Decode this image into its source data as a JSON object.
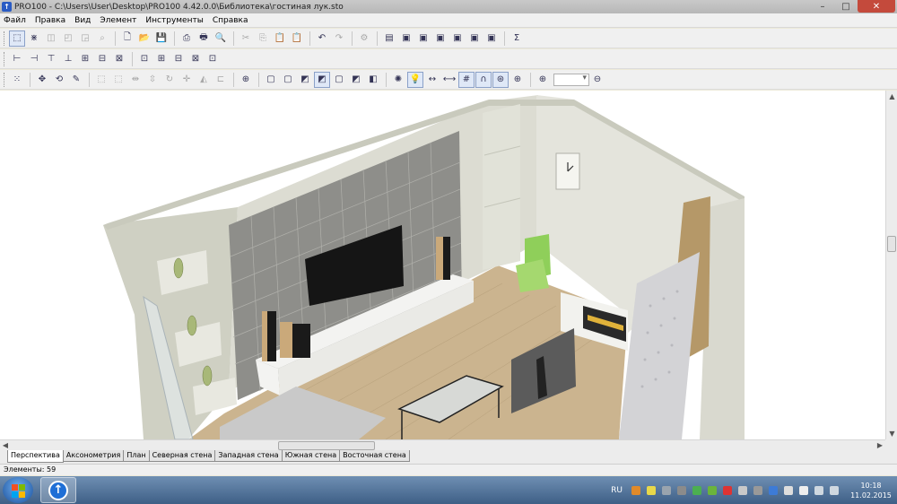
{
  "window": {
    "title": "PRO100 - C:\\Users\\User\\Desktop\\PRO100 4.42.0.0\\Библиотека\\гостиная лук.sto",
    "minimize": "–",
    "maximize": "□",
    "close": "✕"
  },
  "menu": [
    "Файл",
    "Правка",
    "Вид",
    "Элемент",
    "Инструменты",
    "Справка"
  ],
  "toolbar1": {
    "buttons": [
      {
        "icon": "cursor-select-icon",
        "glyph": "⬚",
        "state": "selected"
      },
      {
        "icon": "grid-select-icon",
        "glyph": "⋇",
        "state": "normal"
      },
      {
        "icon": "box-icon",
        "glyph": "◫",
        "state": "disabled"
      },
      {
        "icon": "box-rotate-icon",
        "glyph": "◰",
        "state": "disabled"
      },
      {
        "icon": "box-group-icon",
        "glyph": "◲",
        "state": "disabled"
      },
      {
        "icon": "zoom-find-icon",
        "glyph": "⌕",
        "state": "disabled"
      },
      {
        "icon": "new-file-icon",
        "glyph": "🗋",
        "state": "normal"
      },
      {
        "icon": "open-folder-icon",
        "glyph": "📂",
        "state": "normal"
      },
      {
        "icon": "save-icon",
        "glyph": "💾",
        "state": "normal"
      },
      {
        "icon": "export-icon",
        "glyph": "⎙",
        "state": "normal"
      },
      {
        "icon": "print-icon",
        "glyph": "🖶",
        "state": "normal"
      },
      {
        "icon": "print-preview-icon",
        "glyph": "🔍",
        "state": "normal"
      },
      {
        "icon": "cut-icon",
        "glyph": "✂",
        "state": "disabled"
      },
      {
        "icon": "copy-icon",
        "glyph": "⎘",
        "state": "disabled"
      },
      {
        "icon": "paste-icon",
        "glyph": "📋",
        "state": "disabled"
      },
      {
        "icon": "paste-special-icon",
        "glyph": "📋",
        "state": "disabled"
      },
      {
        "icon": "undo-icon",
        "glyph": "↶",
        "state": "normal"
      },
      {
        "icon": "redo-icon",
        "glyph": "↷",
        "state": "disabled"
      },
      {
        "icon": "properties-icon",
        "glyph": "⚙",
        "state": "disabled"
      },
      {
        "icon": "report-icon",
        "glyph": "▤",
        "state": "normal"
      },
      {
        "icon": "view-icon-1",
        "glyph": "▣",
        "state": "normal"
      },
      {
        "icon": "view-icon-2",
        "glyph": "▣",
        "state": "normal"
      },
      {
        "icon": "view-icon-3",
        "glyph": "▣",
        "state": "normal"
      },
      {
        "icon": "view-icon-4",
        "glyph": "▣",
        "state": "normal"
      },
      {
        "icon": "view-icon-5",
        "glyph": "▣",
        "state": "normal"
      },
      {
        "icon": "view-icon-6",
        "glyph": "▣",
        "state": "normal"
      },
      {
        "icon": "sum-icon",
        "glyph": "Σ",
        "state": "normal"
      }
    ]
  },
  "toolbar2": {
    "buttons": [
      {
        "icon": "align-left-icon",
        "glyph": "⊢"
      },
      {
        "icon": "align-center-icon",
        "glyph": "⊣"
      },
      {
        "icon": "align-right-icon",
        "glyph": "⊤"
      },
      {
        "icon": "align-top-icon",
        "glyph": "⊥"
      },
      {
        "icon": "distribute-icon",
        "glyph": "⊞"
      },
      {
        "icon": "stack-icon",
        "glyph": "⊟"
      },
      {
        "icon": "align-group-icon",
        "glyph": "⊠"
      },
      {
        "icon": "align-group-2-icon",
        "glyph": "⊡"
      },
      {
        "icon": "align-group-3-icon",
        "glyph": "⊞"
      },
      {
        "icon": "align-group-4-icon",
        "glyph": "⊟"
      },
      {
        "icon": "align-group-5-icon",
        "glyph": "⊠"
      },
      {
        "icon": "align-group-6-icon",
        "glyph": "⊡"
      }
    ]
  },
  "toolbar3": {
    "buttons": [
      {
        "icon": "snap-grid-icon",
        "glyph": "⁙",
        "state": "normal"
      },
      {
        "icon": "move-icon",
        "glyph": "✥",
        "state": "normal"
      },
      {
        "icon": "rotate-3d-icon",
        "glyph": "⟲",
        "state": "normal"
      },
      {
        "icon": "pencil-icon",
        "glyph": "✎",
        "state": "normal"
      },
      {
        "icon": "frame-icon",
        "glyph": "⬚",
        "state": "disabled"
      },
      {
        "icon": "frame-2-icon",
        "glyph": "⬚",
        "state": "disabled"
      },
      {
        "icon": "mirror-icon",
        "glyph": "⇹",
        "state": "disabled"
      },
      {
        "icon": "mirror-2-icon",
        "glyph": "⇳",
        "state": "disabled"
      },
      {
        "icon": "rotate-icon",
        "glyph": "↻",
        "state": "disabled"
      },
      {
        "icon": "move-cross-icon",
        "glyph": "✛",
        "state": "disabled"
      },
      {
        "icon": "flip-icon",
        "glyph": "◭",
        "state": "disabled"
      },
      {
        "icon": "step-icon",
        "glyph": "⊏",
        "state": "disabled"
      },
      {
        "icon": "target-icon",
        "glyph": "⊕",
        "state": "normal"
      },
      {
        "icon": "cube-wire-icon",
        "glyph": "▢",
        "state": "normal"
      },
      {
        "icon": "cube-hidden-icon",
        "glyph": "▢",
        "state": "normal"
      },
      {
        "icon": "cube-shaded-icon",
        "glyph": "◩",
        "state": "normal"
      },
      {
        "icon": "cube-textured-icon",
        "glyph": "◩",
        "state": "selected"
      },
      {
        "icon": "cube-outline-icon",
        "glyph": "▢",
        "state": "normal"
      },
      {
        "icon": "cube-solid-icon",
        "glyph": "◩",
        "state": "normal"
      },
      {
        "icon": "cube-color-icon",
        "glyph": "◧",
        "state": "normal"
      },
      {
        "icon": "light-source-icon",
        "glyph": "✺",
        "state": "normal"
      },
      {
        "icon": "lightbulb-icon",
        "glyph": "💡",
        "state": "selected"
      },
      {
        "icon": "dimension-icon",
        "glyph": "↔",
        "state": "normal"
      },
      {
        "icon": "measure-icon",
        "glyph": "⟷",
        "state": "normal"
      },
      {
        "icon": "grid-icon",
        "glyph": "#",
        "state": "selected"
      },
      {
        "icon": "magnet-icon",
        "glyph": "∩",
        "state": "selected"
      },
      {
        "icon": "collision-icon",
        "glyph": "⊛",
        "state": "selected"
      },
      {
        "icon": "target-2-icon",
        "glyph": "⊕",
        "state": "normal"
      },
      {
        "icon": "zoom-in-icon",
        "glyph": "⊕",
        "state": "normal"
      },
      {
        "icon": "zoom-out-icon",
        "glyph": "⊖",
        "state": "normal"
      }
    ],
    "zoom_value": ""
  },
  "scene": {
    "colors": {
      "floor": "#cbb48f",
      "back_wall": "#dcdcd2",
      "left_wall": "#cfd0c3",
      "right_wall": "#e4e4dc",
      "tile_panel": "#8e8e8a",
      "tv": "#151515",
      "cabinet": "#f3f3f1",
      "chair": "#8fcf5a",
      "door": "#d3d3d6"
    }
  },
  "tabs": [
    "Перспектива",
    "Аксонометрия",
    "План",
    "Северная стена",
    "Западная стена",
    "Южная стена",
    "Восточная стена"
  ],
  "active_tab": 0,
  "status": {
    "elements": "Элементы: 59"
  },
  "taskbar": {
    "language": "RU",
    "time": "10:18",
    "date": "11.02.2015"
  }
}
